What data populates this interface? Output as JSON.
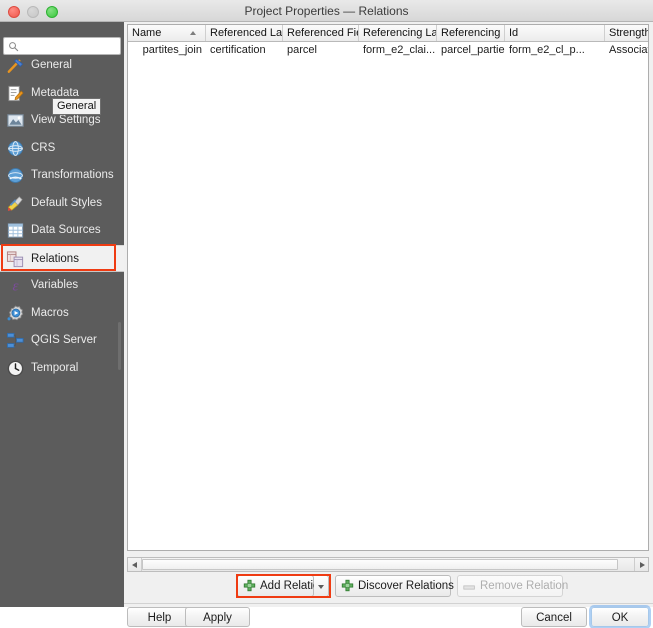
{
  "window": {
    "title": "Project Properties — Relations",
    "controls": {
      "close": "close-button",
      "minimize": "minimize-button",
      "maximize": "maximize-button"
    }
  },
  "sidebar": {
    "search": {
      "value": "",
      "placeholder": ""
    },
    "tooltip": "General",
    "selected": "Relations",
    "items": [
      {
        "label": "General",
        "icon": "hammer-icon"
      },
      {
        "label": "Metadata",
        "icon": "document-pencil-icon"
      },
      {
        "label": "View Settings",
        "icon": "view-image-icon"
      },
      {
        "label": "CRS",
        "icon": "globe-icon"
      },
      {
        "label": "Transformations",
        "icon": "globe-transform-icon"
      },
      {
        "label": "Default Styles",
        "icon": "paintbrush-icon"
      },
      {
        "label": "Data Sources",
        "icon": "table-grid-icon"
      },
      {
        "label": "Relations",
        "icon": "relations-tables-icon"
      },
      {
        "label": "Variables",
        "icon": "epsilon-icon"
      },
      {
        "label": "Macros",
        "icon": "gear-play-icon"
      },
      {
        "label": "QGIS Server",
        "icon": "server-nodes-icon"
      },
      {
        "label": "Temporal",
        "icon": "clock-icon"
      }
    ]
  },
  "table": {
    "columns": [
      {
        "label": "Name",
        "sorted": true
      },
      {
        "label": "Referenced Lay",
        "sorted": false
      },
      {
        "label": "Referenced Fiel",
        "sorted": false
      },
      {
        "label": "Referencing Lay",
        "sorted": false
      },
      {
        "label": "Referencing Fiel",
        "sorted": false
      },
      {
        "label": "Id",
        "sorted": false
      },
      {
        "label": "Strength",
        "sorted": false
      }
    ],
    "rows": [
      {
        "name": "partites_join",
        "referenced_layer": "certification",
        "referenced_field": "parcel",
        "referencing_layer": "form_e2_clai...",
        "referencing_field": "parcel_parties",
        "id": "form_e2_cl_p...",
        "strength": "Association"
      }
    ]
  },
  "toolbar": {
    "add_relation": "Add Relation",
    "discover_relations": "Discover Relations",
    "remove_relation": "Remove Relation",
    "remove_disabled": true,
    "add_highlighted": true
  },
  "footer": {
    "help": "Help",
    "apply": "Apply",
    "cancel": "Cancel",
    "ok": "OK",
    "default_button": "OK"
  },
  "colors": {
    "highlight": "#ef3b12",
    "sidebar_bg": "#5c5c5c",
    "accent_green": "#3c9a3c",
    "focus_blue": "#6eaaeb"
  }
}
